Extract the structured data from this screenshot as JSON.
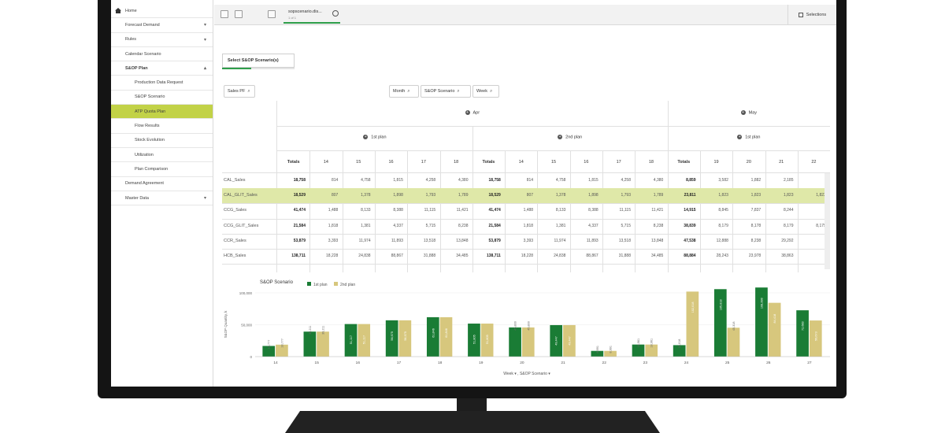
{
  "sidebar": {
    "items": [
      {
        "label": "Home",
        "level": "top",
        "icon": "home-icon"
      },
      {
        "label": "Forecast Demand",
        "level": "top",
        "caret": "▾"
      },
      {
        "label": "Rules",
        "level": "top",
        "caret": "▾"
      },
      {
        "label": "Calendar Scenario",
        "level": "top"
      },
      {
        "label": "S&OP Plan",
        "level": "top",
        "caret": "▴",
        "bold": true
      },
      {
        "label": "Production Data Request",
        "level": "sub"
      },
      {
        "label": "S&OP Scenario",
        "level": "sub"
      },
      {
        "label": "ATP Quota Plan",
        "level": "sub",
        "active": true
      },
      {
        "label": "Flow Results",
        "level": "sub"
      },
      {
        "label": "Stock Evolution",
        "level": "sub"
      },
      {
        "label": "Utilization",
        "level": "sub"
      },
      {
        "label": "Plan Comparison",
        "level": "sub"
      },
      {
        "label": "Demand Agreement",
        "level": "top"
      },
      {
        "label": "Master Data",
        "level": "top",
        "caret": "▾"
      }
    ]
  },
  "toolbar": {
    "sheet_title": "sopscenario.dis...",
    "sheet_subtitle": "1 of 1",
    "selections_label": "Selections"
  },
  "scenario_button": {
    "label": "Select S&OP Scenario(s)",
    "progress": 0.4
  },
  "filters": {
    "sales_pf": "Sales PF",
    "month": "Month",
    "scenario": "S&OP Scenario",
    "week": "Week"
  },
  "pivot": {
    "months": [
      "Apr",
      "May"
    ],
    "plans": [
      "1st plan",
      "2nd plan",
      "1st plan"
    ],
    "columns": [
      "Totals",
      "14",
      "15",
      "16",
      "17",
      "18",
      "Totals",
      "14",
      "15",
      "16",
      "17",
      "18",
      "Totals",
      "19",
      "20",
      "21",
      "22"
    ],
    "rows": [
      {
        "label": "CAL_Sales",
        "values": [
          "18,758",
          "814",
          "4,758",
          "1,815",
          "4,258",
          "4,380",
          "18,758",
          "814",
          "4,758",
          "1,815",
          "4,258",
          "4,380",
          "8,859",
          "3,582",
          "1,882",
          "2,185",
          "-"
        ]
      },
      {
        "label": "CAL_GLIT_Sales",
        "values": [
          "18,529",
          "807",
          "1,378",
          "1,898",
          "1,793",
          "1,789",
          "18,529",
          "807",
          "1,378",
          "1,898",
          "1,793",
          "1,789",
          "23,811",
          "1,823",
          "1,823",
          "1,823",
          "1,823"
        ],
        "highlight": true
      },
      {
        "label": "CCG_Sales",
        "values": [
          "41,474",
          "1,488",
          "8,133",
          "8,388",
          "11,115",
          "11,421",
          "41,474",
          "1,488",
          "8,133",
          "8,388",
          "11,115",
          "11,421",
          "14,915",
          "8,845",
          "7,837",
          "8,244",
          "-"
        ]
      },
      {
        "label": "CCG_GLIT_Sales",
        "values": [
          "21,584",
          "1,818",
          "1,381",
          "4,337",
          "5,715",
          "8,238",
          "21,584",
          "1,818",
          "1,381",
          "4,337",
          "5,715",
          "8,238",
          "38,839",
          "8,179",
          "8,178",
          "8,179",
          "8,179"
        ]
      },
      {
        "label": "CCR_Sales",
        "values": [
          "53,879",
          "3,393",
          "11,974",
          "11,893",
          "13,518",
          "13,848",
          "53,879",
          "3,393",
          "11,974",
          "11,893",
          "13,518",
          "13,848",
          "47,538",
          "12,888",
          "8,238",
          "29,292",
          "-"
        ]
      },
      {
        "label": "HCB_Sales",
        "values": [
          "138,711",
          "18,228",
          "24,838",
          "88,867",
          "31,888",
          "34,485",
          "138,711",
          "18,228",
          "24,838",
          "88,867",
          "31,888",
          "34,485",
          "88,884",
          "28,243",
          "23,978",
          "38,863",
          "-"
        ]
      }
    ]
  },
  "chart_data": {
    "type": "bar",
    "title": "S&OP Scenario",
    "xlabel": "Week ▾ , S&OP Scenario ▾",
    "ylabel": "S&OP Quantity, k",
    "ylim": [
      0,
      100000
    ],
    "yticks": [
      "100,000",
      "50,000",
      "0"
    ],
    "categories": [
      "14",
      "15",
      "16",
      "17",
      "18",
      "19",
      "20",
      "21",
      "22",
      "23",
      "24",
      "25",
      "26",
      "27"
    ],
    "series": [
      {
        "name": "1st plan",
        "color": "#1a7c35",
        "values": [
          16777,
          39211,
          51117,
          56975,
          61846,
          51805,
          45800,
          49447,
          8991,
          18961,
          18018,
          105818,
          108398,
          72683
        ],
        "labels": [
          "16,777",
          "39,211",
          "51,117",
          "56,975",
          "61,846",
          "51,805",
          "45,800",
          "49,447",
          "8,991",
          "18,961",
          "18,018",
          "105,818",
          "108,398",
          "72,683"
        ]
      },
      {
        "name": "2nd plan",
        "color": "#d7c77d",
        "values": [
          18777,
          39211,
          51117,
          56975,
          61846,
          51805,
          45800,
          49447,
          8991,
          18961,
          102018,
          45318,
          84418,
          56673
        ],
        "labels": [
          "18,777",
          "39,211",
          "51,117",
          "56,975",
          "61,846",
          "51,805",
          "45,800",
          "49,447",
          "8,991",
          "18,961",
          "102,018",
          "45,318",
          "84,418",
          "56,673"
        ]
      }
    ],
    "legend_placement": "top-left"
  },
  "colors": {
    "accent": "#2e9e4a",
    "highlight_row": "#dfe8a8",
    "active_sidebar": "#c2d247",
    "bezel": "#141414"
  }
}
